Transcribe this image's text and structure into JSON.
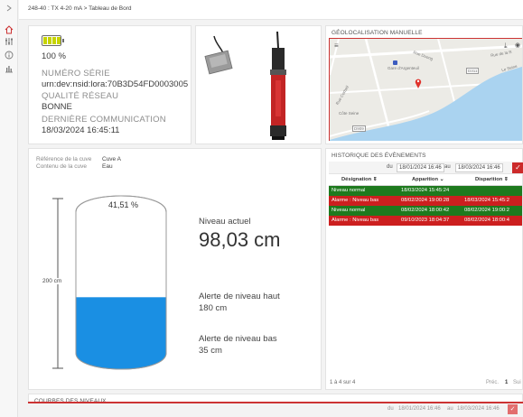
{
  "breadcrumb": {
    "text": "248-40 : TX 4-20 mA > Tableau de Bord"
  },
  "device": {
    "battery_percent": "100 %",
    "battery_level": 1.0,
    "serial_label": "NUMÉRO SÉRIE",
    "serial_value": "urn:dev:nsid:lora:70B3D54FD0003005",
    "network_label": "QUALITÉ RÉSEAU",
    "network_value": "BONNE",
    "lastcomm_label": "DERNIÈRE COMMUNICATION",
    "lastcomm_value": "18/03/2024 16:45:11"
  },
  "map": {
    "title": "GÉOLOCALISATION MANUELLE",
    "labels": {
      "street1": "Rue Duong",
      "street2": "Rue de la R",
      "station": "Gare d'Argenteuil",
      "street3": "Rue Corbeil",
      "road1": "D311",
      "road2": "D909",
      "park": "Côte Seine",
      "street4": "Le Seine"
    }
  },
  "tank": {
    "ref_label": "Référence de la cuve",
    "ref_value": "Cuve A",
    "content_label": "Contenu de la cuve",
    "content_value": "Eau",
    "fill_percent_text": "41,51 %",
    "fill_level": 0.4151,
    "height_label": "200 cm",
    "current_level_label": "Niveau actuel",
    "current_level_value": "98,03 cm",
    "high_alert_label": "Alerte de niveau haut",
    "high_alert_value": "180 cm",
    "low_alert_label": "Alerte de niveau bas",
    "low_alert_value": "35 cm",
    "fill_color": "#1a8fe3"
  },
  "events": {
    "title": "HISTORIQUE DES ÉVÈNEMENTS",
    "from_label": "du",
    "from_value": "18/01/2024 16:46",
    "to_label": "au",
    "to_value": "18/03/2024 16:46",
    "headers": [
      "Désignation ⇕",
      "Apparition ⌄",
      "Disparition ⇕"
    ],
    "rows": [
      {
        "designation": "Niveau normal",
        "apparition": "18/03/2024 15:45:24",
        "disparition": "",
        "status": "green"
      },
      {
        "designation": "Alarme : Niveau bas",
        "apparition": "08/02/2024 19:00:28",
        "disparition": "18/03/2024 15:45:2",
        "status": "red"
      },
      {
        "designation": "Niveau normal",
        "apparition": "08/02/2024 18:00:42",
        "disparition": "08/02/2024 19:00:2",
        "status": "green"
      },
      {
        "designation": "Alarme : Niveau bas",
        "apparition": "09/10/2023 18:04:37",
        "disparition": "08/02/2024 18:00:4",
        "status": "red"
      }
    ],
    "count_text": "1 à 4 sur 4",
    "prev_label": "Préc.",
    "page_number": "1",
    "next_label": "Sui"
  },
  "curves": {
    "title": "COURBES DES NIVEAUX",
    "from_label": "du",
    "from_value": "18/01/2024 16:46",
    "to_label": "au",
    "to_value": "18/03/2024 16:46"
  },
  "colors": {
    "accent_red": "#cc2a2a",
    "ok_green": "#1e7a1e",
    "water_blue": "#1a8fe3"
  }
}
